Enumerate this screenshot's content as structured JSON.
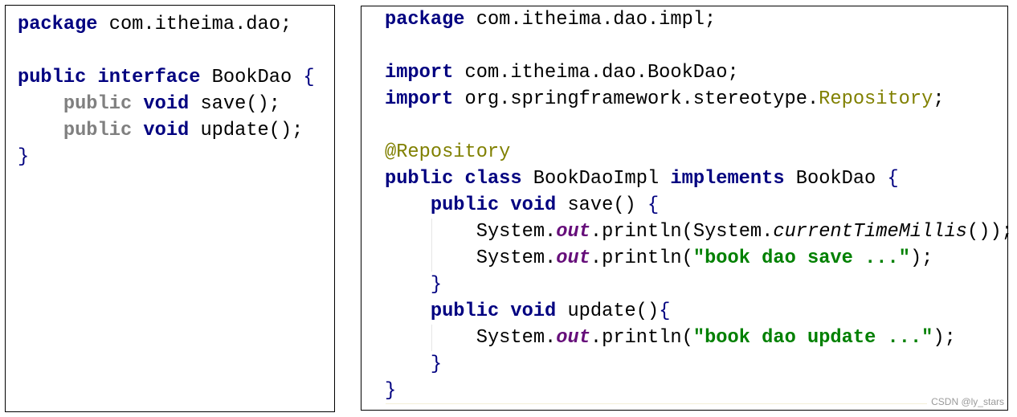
{
  "colors": {
    "keyword": "#000080",
    "annotation": "#808000",
    "field": "#660e7a",
    "string": "#008000",
    "inactive": "#808080"
  },
  "left_pane": {
    "lines": [
      {
        "indent": 0,
        "tokens": [
          {
            "t": "kw",
            "v": "package"
          },
          {
            "t": "txt",
            "v": " com.itheima.dao;"
          }
        ]
      },
      {
        "indent": 0,
        "tokens": []
      },
      {
        "indent": 0,
        "tokens": [
          {
            "t": "kw",
            "v": "public"
          },
          {
            "t": "txt",
            "v": " "
          },
          {
            "t": "kw",
            "v": "interface"
          },
          {
            "t": "txt",
            "v": " BookDao "
          },
          {
            "t": "brace",
            "v": "{"
          }
        ]
      },
      {
        "indent": 1,
        "tokens": [
          {
            "t": "gray",
            "v": "public"
          },
          {
            "t": "txt",
            "v": " "
          },
          {
            "t": "kw",
            "v": "void"
          },
          {
            "t": "txt",
            "v": " save();"
          }
        ]
      },
      {
        "indent": 1,
        "tokens": [
          {
            "t": "gray",
            "v": "public"
          },
          {
            "t": "txt",
            "v": " "
          },
          {
            "t": "kw",
            "v": "void"
          },
          {
            "t": "txt",
            "v": " update();"
          }
        ]
      },
      {
        "indent": 0,
        "tokens": [
          {
            "t": "brace",
            "v": "}"
          }
        ]
      }
    ]
  },
  "right_pane": {
    "lines": [
      {
        "indent": 0,
        "tokens": [
          {
            "t": "kw",
            "v": "package"
          },
          {
            "t": "txt",
            "v": " com.itheima.dao.impl;"
          }
        ]
      },
      {
        "indent": 0,
        "tokens": []
      },
      {
        "indent": 0,
        "tokens": [
          {
            "t": "kw",
            "v": "import"
          },
          {
            "t": "txt",
            "v": " com.itheima.dao.BookDao;"
          }
        ]
      },
      {
        "indent": 0,
        "tokens": [
          {
            "t": "kw",
            "v": "import"
          },
          {
            "t": "txt",
            "v": " org.springframework.stereotype."
          },
          {
            "t": "ann",
            "v": "Repository"
          },
          {
            "t": "txt",
            "v": ";"
          }
        ]
      },
      {
        "indent": 0,
        "tokens": []
      },
      {
        "indent": 0,
        "tokens": [
          {
            "t": "ann",
            "v": "@Repository"
          }
        ]
      },
      {
        "indent": 0,
        "tokens": [
          {
            "t": "kw",
            "v": "public"
          },
          {
            "t": "txt",
            "v": " "
          },
          {
            "t": "kw",
            "v": "class"
          },
          {
            "t": "txt",
            "v": " BookDaoImpl "
          },
          {
            "t": "kw",
            "v": "implements"
          },
          {
            "t": "txt",
            "v": " BookDao "
          },
          {
            "t": "brace",
            "v": "{"
          }
        ]
      },
      {
        "indent": 1,
        "tokens": [
          {
            "t": "kw",
            "v": "public"
          },
          {
            "t": "txt",
            "v": " "
          },
          {
            "t": "kw",
            "v": "void"
          },
          {
            "t": "txt",
            "v": " save() "
          },
          {
            "t": "brace",
            "v": "{"
          }
        ]
      },
      {
        "indent": 2,
        "tokens": [
          {
            "t": "txt",
            "v": "System."
          },
          {
            "t": "field",
            "v": "out"
          },
          {
            "t": "txt",
            "v": ".println(System."
          },
          {
            "t": "static",
            "v": "currentTimeMillis"
          },
          {
            "t": "txt",
            "v": "());"
          }
        ]
      },
      {
        "indent": 2,
        "tokens": [
          {
            "t": "txt",
            "v": "System."
          },
          {
            "t": "field",
            "v": "out"
          },
          {
            "t": "txt",
            "v": ".println("
          },
          {
            "t": "str",
            "v": "\"book dao save ...\""
          },
          {
            "t": "txt",
            "v": ");"
          }
        ]
      },
      {
        "indent": 1,
        "tokens": [
          {
            "t": "brace",
            "v": "}"
          }
        ]
      },
      {
        "indent": 1,
        "tokens": [
          {
            "t": "kw",
            "v": "public"
          },
          {
            "t": "txt",
            "v": " "
          },
          {
            "t": "kw",
            "v": "void"
          },
          {
            "t": "txt",
            "v": " update()"
          },
          {
            "t": "brace",
            "v": "{"
          }
        ]
      },
      {
        "indent": 2,
        "tokens": [
          {
            "t": "txt",
            "v": "System."
          },
          {
            "t": "field",
            "v": "out"
          },
          {
            "t": "txt",
            "v": ".println("
          },
          {
            "t": "str",
            "v": "\"book dao update ...\""
          },
          {
            "t": "txt",
            "v": ");"
          }
        ]
      },
      {
        "indent": 1,
        "tokens": [
          {
            "t": "brace",
            "v": "}"
          }
        ]
      },
      {
        "indent": 0,
        "tokens": [
          {
            "t": "brace",
            "v": "}"
          }
        ]
      }
    ]
  },
  "watermark": "CSDN @ly_stars"
}
